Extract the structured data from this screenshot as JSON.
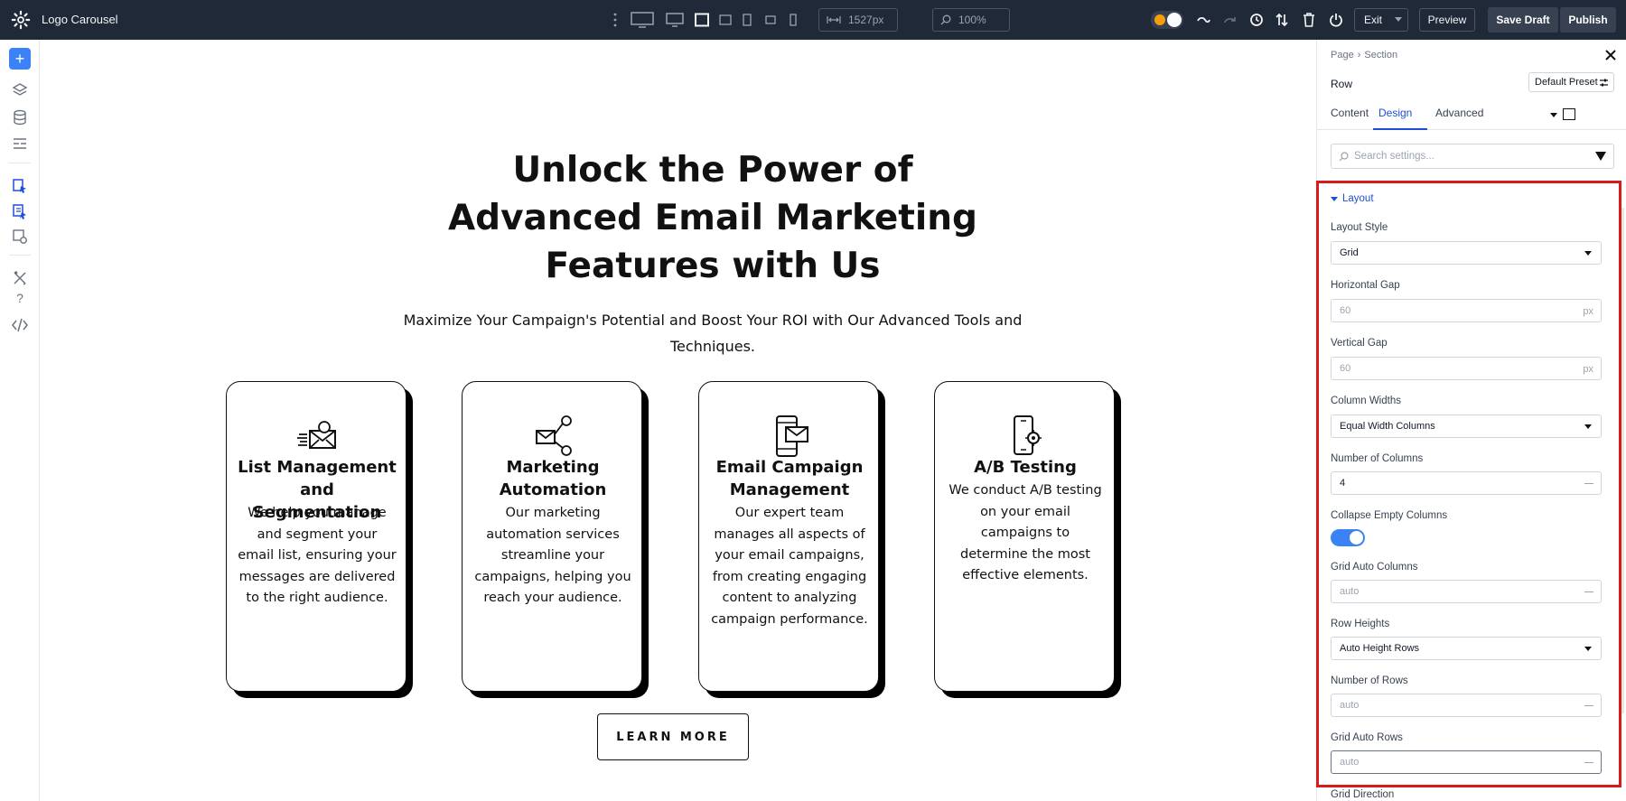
{
  "app": {
    "title": "Logo Carousel"
  },
  "toolbar": {
    "width_value": "1527px",
    "zoom_value": "100%",
    "exit_label": "Exit",
    "preview_label": "Preview",
    "save_draft_label": "Save Draft",
    "publish_label": "Publish",
    "accent_color": "#3b82f6"
  },
  "canvas": {
    "headline": "Unlock the Power of Advanced Email Marketing Features with Us",
    "subtitle": "Maximize Your Campaign's Potential and Boost Your ROI with Our Advanced Tools and Techniques.",
    "cards": [
      {
        "icon": "email-list-icon",
        "title": "List Management and Segmentation",
        "body": "We help you manage and segment your email list, ensuring your messages are delivered to the right audience."
      },
      {
        "icon": "automation-network-icon",
        "title": "Marketing Automation",
        "body": "Our marketing automation services streamline your campaigns, helping you reach your audience."
      },
      {
        "icon": "campaign-phone-email-icon",
        "title": "Email Campaign Management",
        "body": "Our expert team manages all aspects of your email campaigns, from creating engaging content to analyzing campaign performance."
      },
      {
        "icon": "ab-testing-phone-icon",
        "title": "A/B Testing",
        "body": "We conduct A/B testing on your email campaigns to determine the most effective elements."
      }
    ],
    "cta_label": "LEARN MORE"
  },
  "panel": {
    "breadcrumb": [
      "Page",
      "Section"
    ],
    "element_title": "Row",
    "preset_label": "Default Preset",
    "tabs": [
      {
        "label": "Content",
        "active": false
      },
      {
        "label": "Design",
        "active": true
      },
      {
        "label": "Advanced",
        "active": false
      }
    ],
    "search_placeholder": "Search settings...",
    "section_title": "Layout",
    "highlight_color": "#d81b1b",
    "fields": {
      "layout_style": {
        "label": "Layout Style",
        "value": "Grid"
      },
      "horizontal_gap": {
        "label": "Horizontal Gap",
        "value": "60",
        "unit": "px"
      },
      "vertical_gap": {
        "label": "Vertical Gap",
        "value": "60",
        "unit": "px"
      },
      "column_widths": {
        "label": "Column Widths",
        "value": "Equal Width Columns"
      },
      "number_of_columns": {
        "label": "Number of Columns",
        "value": "4"
      },
      "collapse_empty": {
        "label": "Collapse Empty Columns",
        "enabled": true
      },
      "grid_auto_columns": {
        "label": "Grid Auto Columns",
        "value": "auto"
      },
      "row_heights": {
        "label": "Row Heights",
        "value": "Auto Height Rows"
      },
      "number_of_rows": {
        "label": "Number of Rows",
        "value": "auto"
      },
      "grid_auto_rows": {
        "label": "Grid Auto Rows",
        "value": "auto"
      },
      "grid_direction": {
        "label": "Grid Direction"
      }
    }
  }
}
